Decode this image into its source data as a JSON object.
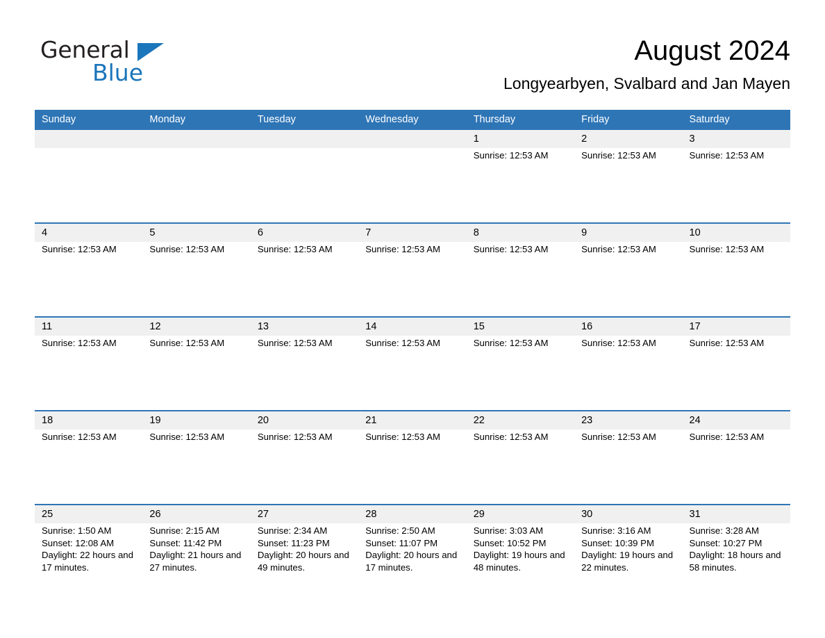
{
  "brand": {
    "logo_text_primary": "General",
    "logo_text_secondary": "Blue",
    "logo_color": "#1b75bb"
  },
  "header": {
    "title": "August 2024",
    "subtitle": "Longyearbyen, Svalbard and Jan Mayen"
  },
  "theme": {
    "header_blue": "#2e75b6",
    "day_band_gray": "#f0f0f0",
    "text_black": "#000000",
    "header_text": "#ffffff"
  },
  "calendar": {
    "weekdays": [
      "Sunday",
      "Monday",
      "Tuesday",
      "Wednesday",
      "Thursday",
      "Friday",
      "Saturday"
    ],
    "weeks": [
      {
        "days": [
          {
            "number": "",
            "lines": []
          },
          {
            "number": "",
            "lines": []
          },
          {
            "number": "",
            "lines": []
          },
          {
            "number": "",
            "lines": []
          },
          {
            "number": "1",
            "lines": [
              "Sunrise: 12:53 AM"
            ]
          },
          {
            "number": "2",
            "lines": [
              "Sunrise: 12:53 AM"
            ]
          },
          {
            "number": "3",
            "lines": [
              "Sunrise: 12:53 AM"
            ]
          }
        ]
      },
      {
        "days": [
          {
            "number": "4",
            "lines": [
              "Sunrise: 12:53 AM"
            ]
          },
          {
            "number": "5",
            "lines": [
              "Sunrise: 12:53 AM"
            ]
          },
          {
            "number": "6",
            "lines": [
              "Sunrise: 12:53 AM"
            ]
          },
          {
            "number": "7",
            "lines": [
              "Sunrise: 12:53 AM"
            ]
          },
          {
            "number": "8",
            "lines": [
              "Sunrise: 12:53 AM"
            ]
          },
          {
            "number": "9",
            "lines": [
              "Sunrise: 12:53 AM"
            ]
          },
          {
            "number": "10",
            "lines": [
              "Sunrise: 12:53 AM"
            ]
          }
        ]
      },
      {
        "days": [
          {
            "number": "11",
            "lines": [
              "Sunrise: 12:53 AM"
            ]
          },
          {
            "number": "12",
            "lines": [
              "Sunrise: 12:53 AM"
            ]
          },
          {
            "number": "13",
            "lines": [
              "Sunrise: 12:53 AM"
            ]
          },
          {
            "number": "14",
            "lines": [
              "Sunrise: 12:53 AM"
            ]
          },
          {
            "number": "15",
            "lines": [
              "Sunrise: 12:53 AM"
            ]
          },
          {
            "number": "16",
            "lines": [
              "Sunrise: 12:53 AM"
            ]
          },
          {
            "number": "17",
            "lines": [
              "Sunrise: 12:53 AM"
            ]
          }
        ]
      },
      {
        "days": [
          {
            "number": "18",
            "lines": [
              "Sunrise: 12:53 AM"
            ]
          },
          {
            "number": "19",
            "lines": [
              "Sunrise: 12:53 AM"
            ]
          },
          {
            "number": "20",
            "lines": [
              "Sunrise: 12:53 AM"
            ]
          },
          {
            "number": "21",
            "lines": [
              "Sunrise: 12:53 AM"
            ]
          },
          {
            "number": "22",
            "lines": [
              "Sunrise: 12:53 AM"
            ]
          },
          {
            "number": "23",
            "lines": [
              "Sunrise: 12:53 AM"
            ]
          },
          {
            "number": "24",
            "lines": [
              "Sunrise: 12:53 AM"
            ]
          }
        ]
      },
      {
        "days": [
          {
            "number": "25",
            "lines": [
              "Sunrise: 1:50 AM",
              "Sunset: 12:08 AM",
              "Daylight: 22 hours and 17 minutes."
            ]
          },
          {
            "number": "26",
            "lines": [
              "Sunrise: 2:15 AM",
              "Sunset: 11:42 PM",
              "Daylight: 21 hours and 27 minutes."
            ]
          },
          {
            "number": "27",
            "lines": [
              "Sunrise: 2:34 AM",
              "Sunset: 11:23 PM",
              "Daylight: 20 hours and 49 minutes."
            ]
          },
          {
            "number": "28",
            "lines": [
              "Sunrise: 2:50 AM",
              "Sunset: 11:07 PM",
              "Daylight: 20 hours and 17 minutes."
            ]
          },
          {
            "number": "29",
            "lines": [
              "Sunrise: 3:03 AM",
              "Sunset: 10:52 PM",
              "Daylight: 19 hours and 48 minutes."
            ]
          },
          {
            "number": "30",
            "lines": [
              "Sunrise: 3:16 AM",
              "Sunset: 10:39 PM",
              "Daylight: 19 hours and 22 minutes."
            ]
          },
          {
            "number": "31",
            "lines": [
              "Sunrise: 3:28 AM",
              "Sunset: 10:27 PM",
              "Daylight: 18 hours and 58 minutes."
            ]
          }
        ]
      }
    ]
  }
}
